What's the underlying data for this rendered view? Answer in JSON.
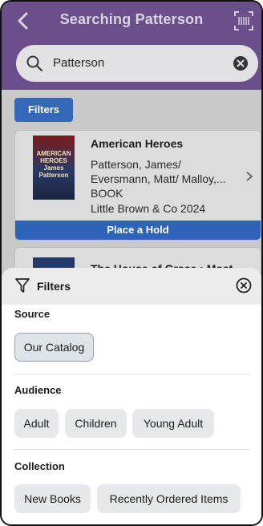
{
  "header": {
    "title": "Searching Patterson"
  },
  "search": {
    "value": "Patterson"
  },
  "results": {
    "filters_button_label": "Filters",
    "items": [
      {
        "cover_text": "AMERICAN HEROES James Patterson",
        "title": "American Heroes",
        "author_line1": "Patterson, James/",
        "author_line2": "Eversmann, Matt/ Malloy,...",
        "format": "BOOK",
        "publisher_year": "Little Brown & Co 2024",
        "action_label": "Place a Hold"
      },
      {
        "title_partial": "The House of Grace : Most"
      }
    ]
  },
  "filters_sheet": {
    "title": "Filters",
    "sections": [
      {
        "title": "Source",
        "options": [
          "Our Catalog"
        ],
        "selected": "Our Catalog"
      },
      {
        "title": "Audience",
        "options": [
          "Adult",
          "Children",
          "Young Adult"
        ]
      },
      {
        "title": "Collection",
        "options": [
          "New Books",
          "Recently Ordered Items"
        ]
      }
    ]
  },
  "colors": {
    "header_purple": "#6b4f8a",
    "primary_blue": "#2d63b8",
    "chip_bg": "#e6e8eb"
  },
  "icons": [
    "back-icon",
    "barcode-icon",
    "search-icon",
    "clear-icon",
    "chevron-right-icon",
    "filter-icon",
    "close-icon"
  ]
}
